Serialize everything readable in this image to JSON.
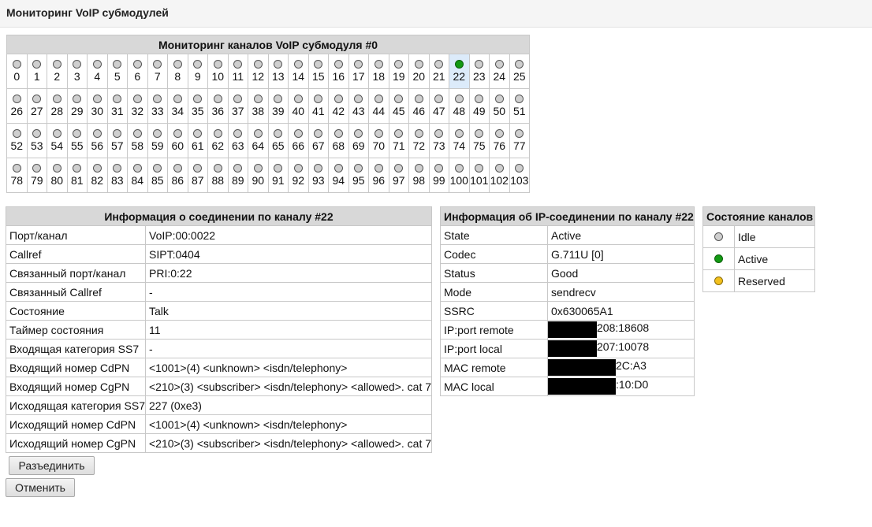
{
  "header": {
    "title": "Мониторинг VoIP субмодулей"
  },
  "channels": {
    "title": "Мониторинг каналов VoIP субмодуля #0",
    "per_row": 26,
    "count": 104,
    "active": [
      22
    ],
    "selected": 22
  },
  "connection": {
    "title": "Информация о соединении по каналу #22",
    "rows": [
      {
        "label": "Порт/канал",
        "value": "VoIP:00:0022"
      },
      {
        "label": "Callref",
        "value": "SIPT:0404"
      },
      {
        "label": "Связанный порт/канал",
        "value": "PRI:0:22"
      },
      {
        "label": "Связанный Callref",
        "value": "-"
      },
      {
        "label": "Состояние",
        "value": "Talk"
      },
      {
        "label": "Таймер состояния",
        "value": "11"
      },
      {
        "label": "Входящая категория SS7",
        "value": "-"
      },
      {
        "label": "Входящий номер CdPN",
        "value": "<1001>(4) <unknown> <isdn/telephony>"
      },
      {
        "label": "Входящий номер CgPN",
        "value": "<210>(3) <subscriber> <isdn/telephony> <allowed>. cat 7"
      },
      {
        "label": "Исходящая категория SS7",
        "value": "227 (0xe3)"
      },
      {
        "label": "Исходящий номер CdPN",
        "value": "<1001>(4) <unknown> <isdn/telephony>"
      },
      {
        "label": "Исходящий номер CgPN",
        "value": "<210>(3) <subscriber> <isdn/telephony> <allowed>. cat 7"
      }
    ]
  },
  "ip": {
    "title": "Информация об IP-соединении по каналу #22",
    "rows": [
      {
        "label": "State",
        "value": "Active"
      },
      {
        "label": "Codec",
        "value": "G.711U [0]"
      },
      {
        "label": "Status",
        "value": "Good"
      },
      {
        "label": "Mode",
        "value": "sendrecv"
      },
      {
        "label": "SSRC",
        "value": "0x630065A1"
      },
      {
        "label": "IP:port remote",
        "value": "208:18608"
      },
      {
        "label": "IP:port local",
        "value": "207:10078"
      },
      {
        "label": "MAC remote",
        "value": "2C:A3"
      },
      {
        "label": "MAC local",
        "value": ":10:D0"
      }
    ]
  },
  "legend": {
    "title": "Состояние каналов",
    "items": [
      {
        "label": "Idle",
        "state": "idle",
        "color": "#cfcfcf"
      },
      {
        "label": "Active",
        "state": "active",
        "color": "#139a13"
      },
      {
        "label": "Reserved",
        "state": "reserved",
        "color": "#f2c01d"
      }
    ]
  },
  "buttons": {
    "disconnect": "Разъединить",
    "cancel": "Отменить"
  }
}
